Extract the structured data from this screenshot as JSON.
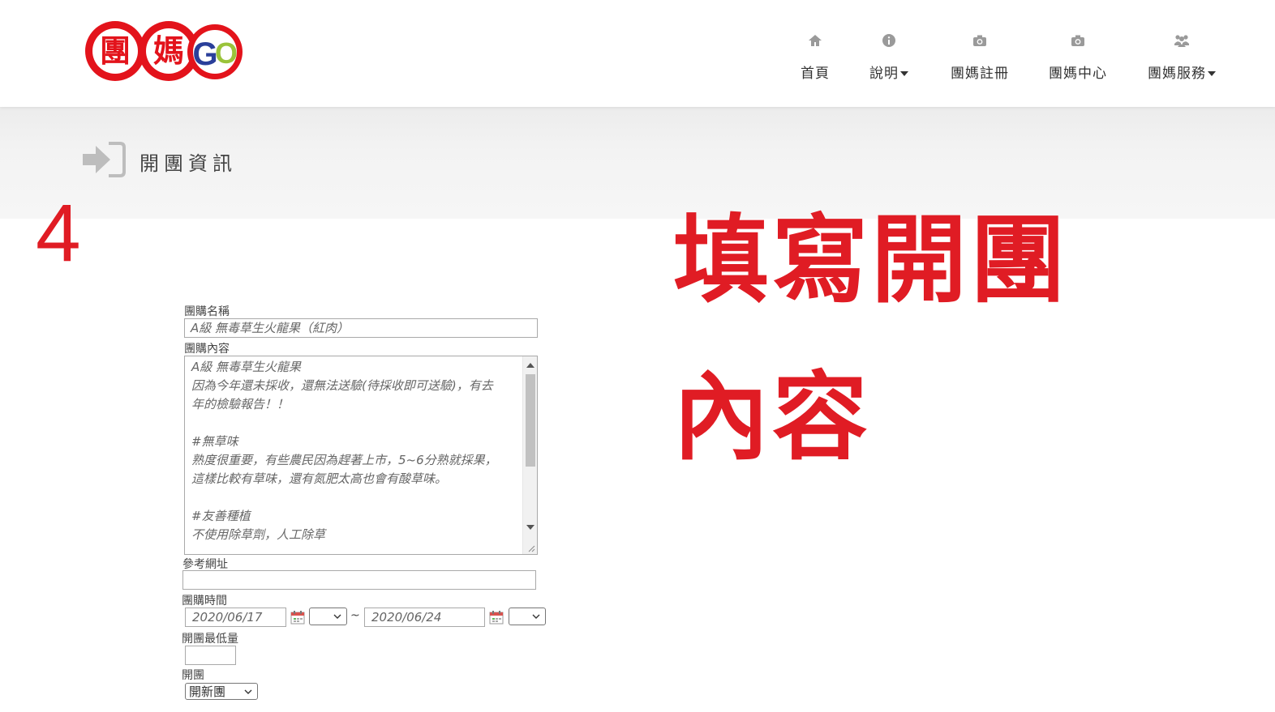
{
  "header": {
    "logo_text": "團媽GO",
    "nav": [
      {
        "label": "首頁",
        "icon": "home-icon",
        "has_caret": false
      },
      {
        "label": "說明",
        "icon": "info-icon",
        "has_caret": true
      },
      {
        "label": "團媽註冊",
        "icon": "camera-icon",
        "has_caret": false
      },
      {
        "label": "團媽中心",
        "icon": "camera-icon",
        "has_caret": false
      },
      {
        "label": "團媽服務",
        "icon": "users-icon",
        "has_caret": true
      }
    ]
  },
  "banner": {
    "title": "開團資訊",
    "icon": "sign-in-icon"
  },
  "annotations": {
    "step": "4",
    "line1": "填寫開團",
    "line2": "內容"
  },
  "form": {
    "name_label": "團購名稱",
    "name_value": "A級 無毒草生火龍果（紅肉）",
    "content_label": "團購內容",
    "content_lines": [
      "A級 無毒草生火龍果",
      "因為今年還未採收，還無法送驗(待採收即可送驗)，有去",
      "年的檢驗報告！！",
      "",
      "#無草味",
      "熟度很重要，有些農民因為趕著上市，5~6分熟就採果，",
      "這樣比較有草味，還有氮肥太高也會有酸草味。",
      "",
      "#友善種植",
      "不使用除草劑，人工除草"
    ],
    "url_label": "參考網址",
    "url_value": "",
    "time_label": "團購時間",
    "start_date": "2020/06/17",
    "start_time": "",
    "separator": "~",
    "end_date": "2020/06/24",
    "end_time": "",
    "min_label": "開團最低量",
    "min_value": "",
    "open_label": "開團",
    "open_value": "開新團"
  },
  "colors": {
    "annotation_red": "#e01c24",
    "logo_red": "#e3131b",
    "logo_blue": "#2a3f9a",
    "logo_green": "#9ac33a"
  }
}
